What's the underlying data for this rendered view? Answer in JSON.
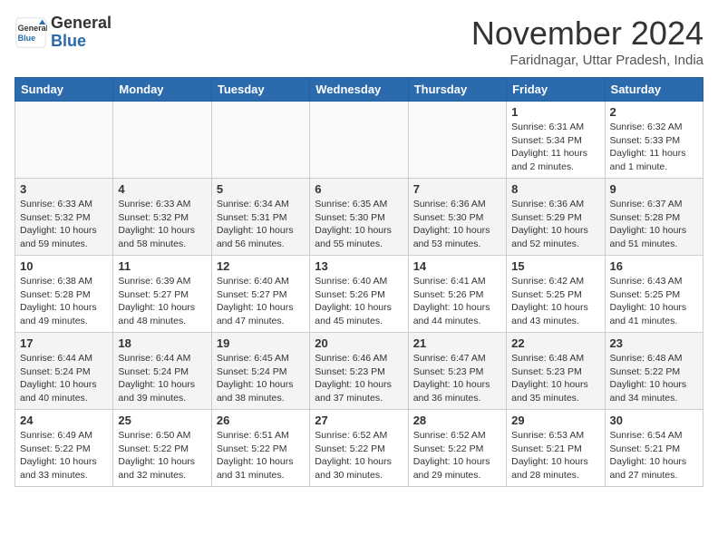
{
  "header": {
    "logo_general": "General",
    "logo_blue": "Blue",
    "month": "November 2024",
    "location": "Faridnagar, Uttar Pradesh, India"
  },
  "weekdays": [
    "Sunday",
    "Monday",
    "Tuesday",
    "Wednesday",
    "Thursday",
    "Friday",
    "Saturday"
  ],
  "weeks": [
    [
      {
        "day": "",
        "info": ""
      },
      {
        "day": "",
        "info": ""
      },
      {
        "day": "",
        "info": ""
      },
      {
        "day": "",
        "info": ""
      },
      {
        "day": "",
        "info": ""
      },
      {
        "day": "1",
        "info": "Sunrise: 6:31 AM\nSunset: 5:34 PM\nDaylight: 11 hours and 2 minutes."
      },
      {
        "day": "2",
        "info": "Sunrise: 6:32 AM\nSunset: 5:33 PM\nDaylight: 11 hours and 1 minute."
      }
    ],
    [
      {
        "day": "3",
        "info": "Sunrise: 6:33 AM\nSunset: 5:32 PM\nDaylight: 10 hours and 59 minutes."
      },
      {
        "day": "4",
        "info": "Sunrise: 6:33 AM\nSunset: 5:32 PM\nDaylight: 10 hours and 58 minutes."
      },
      {
        "day": "5",
        "info": "Sunrise: 6:34 AM\nSunset: 5:31 PM\nDaylight: 10 hours and 56 minutes."
      },
      {
        "day": "6",
        "info": "Sunrise: 6:35 AM\nSunset: 5:30 PM\nDaylight: 10 hours and 55 minutes."
      },
      {
        "day": "7",
        "info": "Sunrise: 6:36 AM\nSunset: 5:30 PM\nDaylight: 10 hours and 53 minutes."
      },
      {
        "day": "8",
        "info": "Sunrise: 6:36 AM\nSunset: 5:29 PM\nDaylight: 10 hours and 52 minutes."
      },
      {
        "day": "9",
        "info": "Sunrise: 6:37 AM\nSunset: 5:28 PM\nDaylight: 10 hours and 51 minutes."
      }
    ],
    [
      {
        "day": "10",
        "info": "Sunrise: 6:38 AM\nSunset: 5:28 PM\nDaylight: 10 hours and 49 minutes."
      },
      {
        "day": "11",
        "info": "Sunrise: 6:39 AM\nSunset: 5:27 PM\nDaylight: 10 hours and 48 minutes."
      },
      {
        "day": "12",
        "info": "Sunrise: 6:40 AM\nSunset: 5:27 PM\nDaylight: 10 hours and 47 minutes."
      },
      {
        "day": "13",
        "info": "Sunrise: 6:40 AM\nSunset: 5:26 PM\nDaylight: 10 hours and 45 minutes."
      },
      {
        "day": "14",
        "info": "Sunrise: 6:41 AM\nSunset: 5:26 PM\nDaylight: 10 hours and 44 minutes."
      },
      {
        "day": "15",
        "info": "Sunrise: 6:42 AM\nSunset: 5:25 PM\nDaylight: 10 hours and 43 minutes."
      },
      {
        "day": "16",
        "info": "Sunrise: 6:43 AM\nSunset: 5:25 PM\nDaylight: 10 hours and 41 minutes."
      }
    ],
    [
      {
        "day": "17",
        "info": "Sunrise: 6:44 AM\nSunset: 5:24 PM\nDaylight: 10 hours and 40 minutes."
      },
      {
        "day": "18",
        "info": "Sunrise: 6:44 AM\nSunset: 5:24 PM\nDaylight: 10 hours and 39 minutes."
      },
      {
        "day": "19",
        "info": "Sunrise: 6:45 AM\nSunset: 5:24 PM\nDaylight: 10 hours and 38 minutes."
      },
      {
        "day": "20",
        "info": "Sunrise: 6:46 AM\nSunset: 5:23 PM\nDaylight: 10 hours and 37 minutes."
      },
      {
        "day": "21",
        "info": "Sunrise: 6:47 AM\nSunset: 5:23 PM\nDaylight: 10 hours and 36 minutes."
      },
      {
        "day": "22",
        "info": "Sunrise: 6:48 AM\nSunset: 5:23 PM\nDaylight: 10 hours and 35 minutes."
      },
      {
        "day": "23",
        "info": "Sunrise: 6:48 AM\nSunset: 5:22 PM\nDaylight: 10 hours and 34 minutes."
      }
    ],
    [
      {
        "day": "24",
        "info": "Sunrise: 6:49 AM\nSunset: 5:22 PM\nDaylight: 10 hours and 33 minutes."
      },
      {
        "day": "25",
        "info": "Sunrise: 6:50 AM\nSunset: 5:22 PM\nDaylight: 10 hours and 32 minutes."
      },
      {
        "day": "26",
        "info": "Sunrise: 6:51 AM\nSunset: 5:22 PM\nDaylight: 10 hours and 31 minutes."
      },
      {
        "day": "27",
        "info": "Sunrise: 6:52 AM\nSunset: 5:22 PM\nDaylight: 10 hours and 30 minutes."
      },
      {
        "day": "28",
        "info": "Sunrise: 6:52 AM\nSunset: 5:22 PM\nDaylight: 10 hours and 29 minutes."
      },
      {
        "day": "29",
        "info": "Sunrise: 6:53 AM\nSunset: 5:21 PM\nDaylight: 10 hours and 28 minutes."
      },
      {
        "day": "30",
        "info": "Sunrise: 6:54 AM\nSunset: 5:21 PM\nDaylight: 10 hours and 27 minutes."
      }
    ]
  ]
}
